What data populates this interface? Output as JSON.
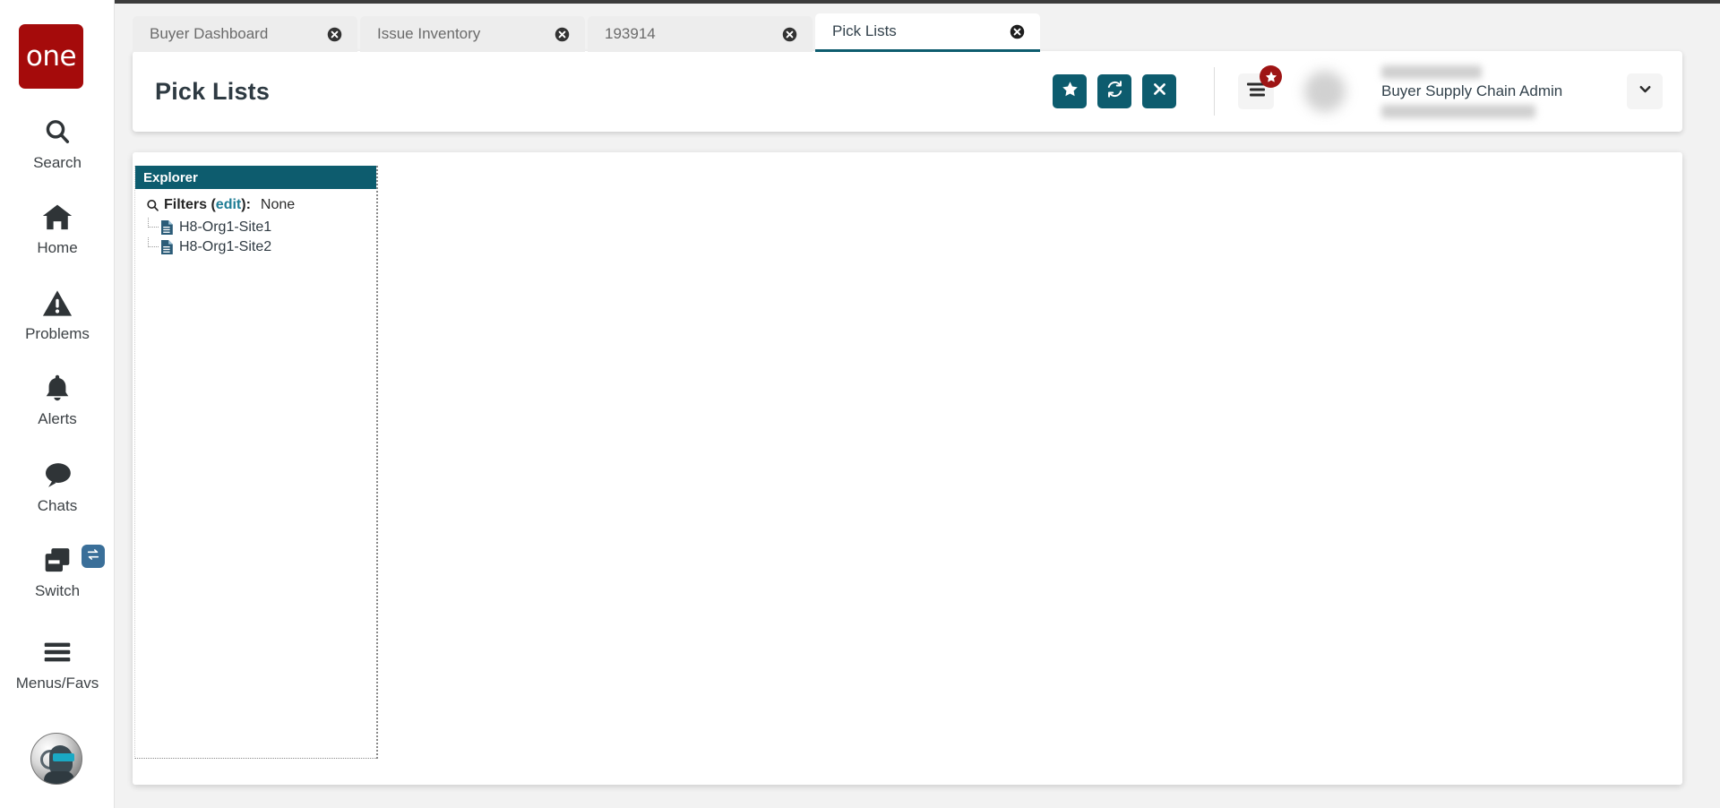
{
  "sidebar": {
    "logo_text": "one",
    "items": [
      {
        "label": "Search",
        "icon": "search-icon"
      },
      {
        "label": "Home",
        "icon": "home-icon"
      },
      {
        "label": "Problems",
        "icon": "warning-triangle-icon"
      },
      {
        "label": "Alerts",
        "icon": "bell-icon"
      },
      {
        "label": "Chats",
        "icon": "chat-bubble-icon"
      },
      {
        "label": "Switch",
        "icon": "switch-windows-icon"
      },
      {
        "label": "Menus/Favs",
        "icon": "hamburger-icon"
      }
    ],
    "switch_badge_icon": "swap-arrows-icon",
    "assistant_avatar_icon": "robot-assistant-icon"
  },
  "tabs": [
    {
      "label": "Buyer Dashboard",
      "active": false
    },
    {
      "label": "Issue Inventory",
      "active": false
    },
    {
      "label": "193914",
      "active": false
    },
    {
      "label": "Pick Lists",
      "active": true
    }
  ],
  "header": {
    "title": "Pick Lists",
    "buttons": [
      {
        "name": "favorite-button",
        "icon": "star-icon"
      },
      {
        "name": "refresh-button",
        "icon": "refresh-icon"
      },
      {
        "name": "close-button",
        "icon": "close-x-icon"
      }
    ],
    "menu_icon": "hamburger-menu-icon",
    "menu_badge_icon": "star-icon",
    "user_role": "Buyer Supply Chain Admin",
    "user_caret_icon": "chevron-down-icon"
  },
  "explorer": {
    "title": "Explorer",
    "search_icon": "search-icon",
    "filters_label": "Filters (",
    "filters_edit": "edit",
    "filters_label_end": "):",
    "filters_value": "None",
    "tree": [
      {
        "label": "H8-Org1-Site1",
        "icon": "document-icon"
      },
      {
        "label": "H8-Org1-Site2",
        "icon": "document-icon"
      }
    ]
  },
  "colors": {
    "teal": "#0d5c6e",
    "brand_red": "#a50b0b",
    "badge_red": "#9e1414",
    "switch_blue": "#3a6f99"
  }
}
